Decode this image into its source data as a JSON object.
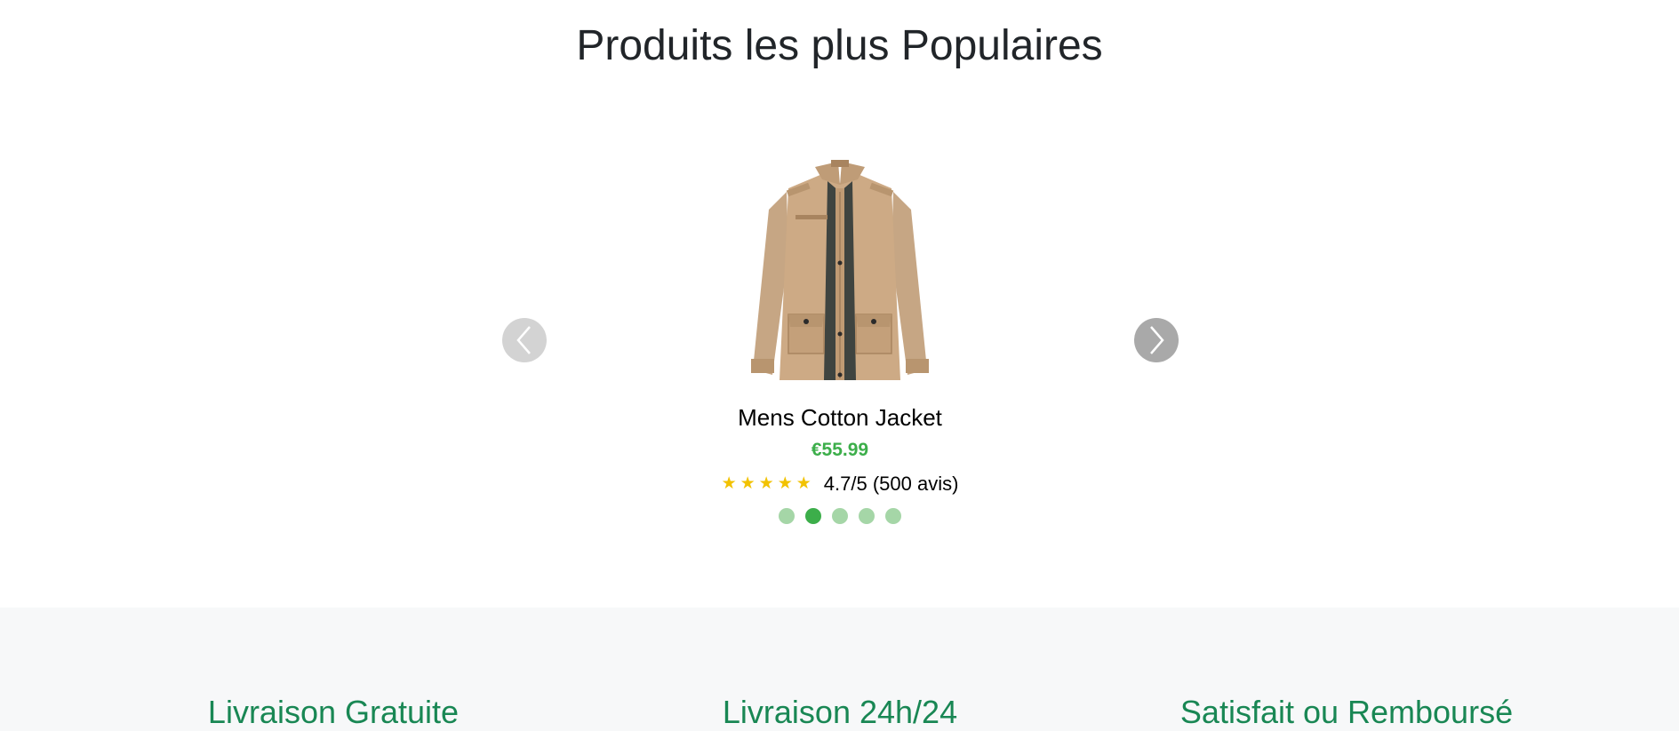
{
  "section": {
    "title": "Produits les plus Populaires"
  },
  "carousel": {
    "product": {
      "name": "Mens Cotton Jacket",
      "price": "€55.99",
      "rating_text": "4.7/5 (500 avis)",
      "stars": 5,
      "image_icon": "jacket-image"
    },
    "dots_count": 5,
    "active_dot": 2,
    "prev_icon": "chevron-left-icon",
    "next_icon": "chevron-right-icon"
  },
  "features": [
    {
      "title": "Livraison Gratuite"
    },
    {
      "title": "Livraison 24h/24"
    },
    {
      "title": "Satisfait ou Remboursé"
    }
  ],
  "colors": {
    "accent_green": "#3cae4a",
    "feature_green": "#198754",
    "star_yellow": "#f2c200",
    "features_bg": "#f7f8f9"
  }
}
